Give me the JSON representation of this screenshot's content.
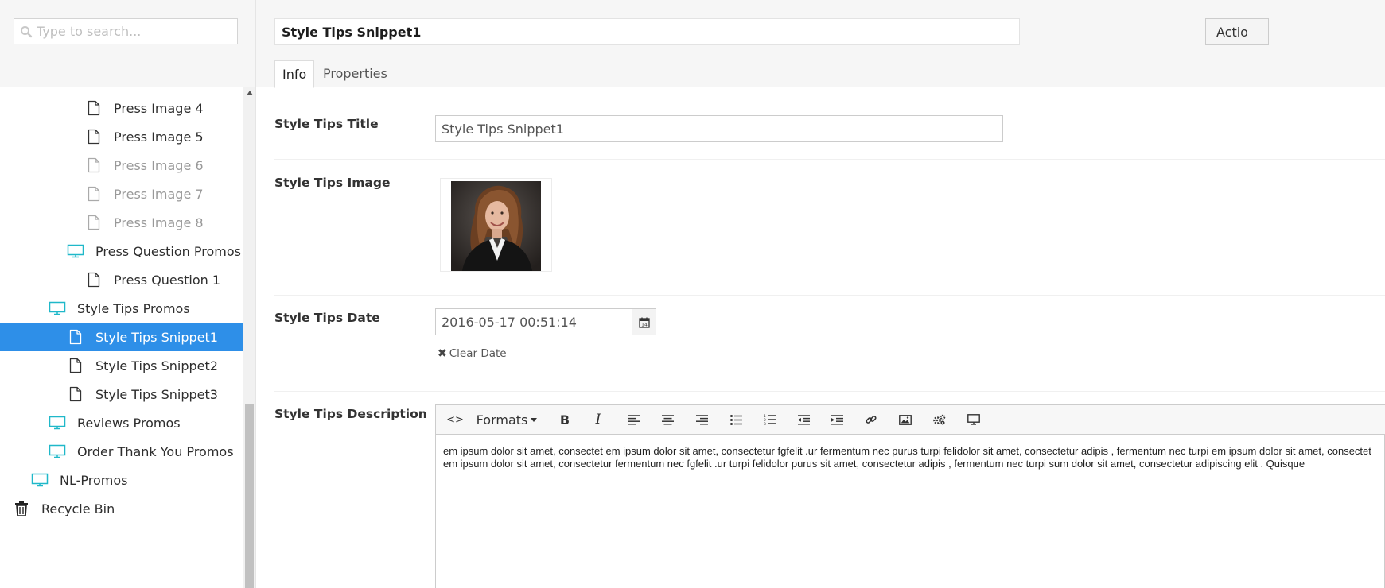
{
  "search": {
    "placeholder": "Type to search..."
  },
  "tree": {
    "items": [
      {
        "label": "Press Image 4",
        "icon": "document-icon",
        "state": "normal"
      },
      {
        "label": "Press Image 5",
        "icon": "document-icon",
        "state": "normal"
      },
      {
        "label": "Press Image 6",
        "icon": "document-icon",
        "state": "dimmed"
      },
      {
        "label": "Press Image 7",
        "icon": "document-icon",
        "state": "dimmed"
      },
      {
        "label": "Press Image 8",
        "icon": "document-icon",
        "state": "dimmed"
      },
      {
        "label": "Press Question Promos",
        "icon": "monitor-icon",
        "state": "normal"
      },
      {
        "label": "Press Question 1",
        "icon": "document-icon",
        "state": "normal"
      },
      {
        "label": "Style Tips Promos",
        "icon": "monitor-icon",
        "state": "normal"
      },
      {
        "label": "Style Tips Snippet1",
        "icon": "document-icon",
        "state": "active"
      },
      {
        "label": "Style Tips Snippet2",
        "icon": "document-icon",
        "state": "normal"
      },
      {
        "label": "Style Tips Snippet3",
        "icon": "document-icon",
        "state": "normal"
      },
      {
        "label": "Reviews Promos",
        "icon": "monitor-icon",
        "state": "normal"
      },
      {
        "label": "Order Thank You Promos",
        "icon": "monitor-icon",
        "state": "normal"
      },
      {
        "label": "NL-Promos",
        "icon": "monitor-icon",
        "state": "normal"
      },
      {
        "label": "Recycle Bin",
        "icon": "trash-icon",
        "state": "normal"
      }
    ]
  },
  "editor": {
    "node_name": "Style Tips Snippet1",
    "actions_label": "Actio",
    "tabs": [
      {
        "label": "Info"
      },
      {
        "label": "Properties"
      }
    ],
    "properties": {
      "title": {
        "label": "Style Tips Title",
        "value": "Style Tips Snippet1"
      },
      "image": {
        "label": "Style Tips Image"
      },
      "date": {
        "label": "Style Tips Date",
        "value": "2016-05-17 00:51:14",
        "clear_label": "Clear Date"
      },
      "description": {
        "label": "Style Tips Description",
        "formats_label": "Formats",
        "content": "em ipsum dolor sit amet, consectet em ipsum dolor sit amet, consectetur fgfelit .ur fermentum nec purus turpi felidolor sit amet, consectetur adipis , fermentum nec turpi em ipsum dolor sit amet, consectet em ipsum dolor sit amet, consectetur fermentum nec fgfelit .ur turpi felidolor purus sit amet, consectetur adipis , fermentum nec turpi sum dolor sit amet, consectetur adipiscing elit . Quisque"
      }
    }
  },
  "colors": {
    "accent": "#2e8fe8",
    "monitor_icon": "#1fb8c9",
    "header_bg": "#f6f6f6"
  }
}
